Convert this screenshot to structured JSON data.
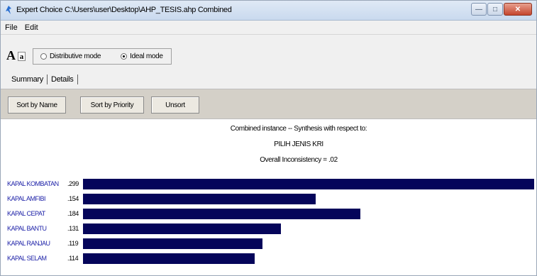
{
  "window": {
    "title": "Expert Choice   C:\\Users\\user\\Desktop\\AHP_TESIS.ahp   Combined"
  },
  "menu": {
    "file": "File",
    "edit": "Edit"
  },
  "toolbar": {
    "font_large": "A",
    "font_small": "a",
    "mode_distributive": "Distributive mode",
    "mode_ideal": "Ideal mode",
    "selected_mode": "ideal"
  },
  "tabs": {
    "summary": "Summary",
    "details": "Details"
  },
  "buttons": {
    "sort_by_name": "Sort by Name",
    "sort_by_priority": "Sort by Priority",
    "unsort": "Unsort"
  },
  "synthesis": {
    "title": "Combined instance -- Synthesis with respect to:",
    "goal": "PILIH JENIS KRI",
    "inconsistency": "Overall Inconsistency = .02"
  },
  "chart_data": {
    "type": "bar",
    "orientation": "horizontal",
    "categories": [
      "KAPAL KOMBATAN",
      "KAPAL AMFIBI",
      "KAPAL CEPAT",
      "KAPAL BANTU",
      "KAPAL RANJAU",
      "KAPAL SELAM"
    ],
    "values": [
      0.299,
      0.154,
      0.184,
      0.131,
      0.119,
      0.114
    ],
    "value_labels": [
      ".299",
      ".154",
      ".184",
      ".131",
      ".119",
      ".114"
    ],
    "bar_color": "#05055a",
    "label_color": "#1e22a8"
  }
}
